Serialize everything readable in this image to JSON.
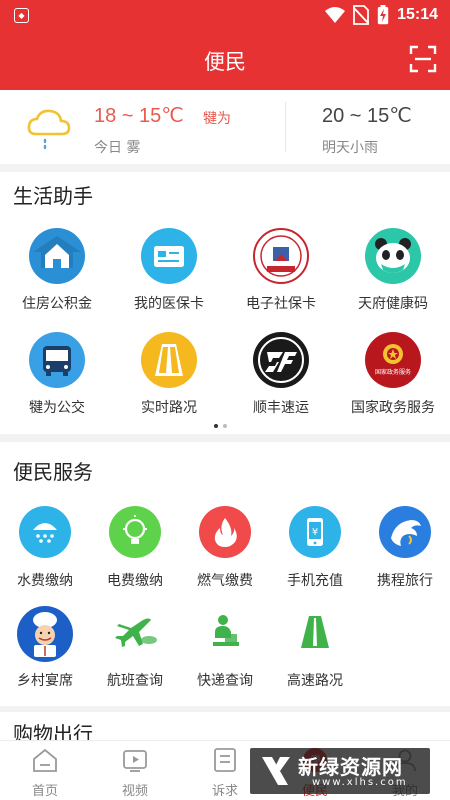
{
  "status_bar": {
    "time": "15:14"
  },
  "header": {
    "title": "便民"
  },
  "weather": {
    "today": {
      "temp": "18 ~ 15℃",
      "city": "犍为",
      "label": "今日 雾"
    },
    "tomorrow": {
      "temp": "20 ~ 15℃",
      "label": "明天小雨"
    }
  },
  "life_assistant": {
    "title": "生活助手",
    "items": [
      {
        "label": "住房公积金",
        "icon": "house-icon"
      },
      {
        "label": "我的医保卡",
        "icon": "medical-card-icon"
      },
      {
        "label": "电子社保卡",
        "icon": "social-security-card-icon"
      },
      {
        "label": "天府健康码",
        "icon": "panda-icon"
      },
      {
        "label": "犍为公交",
        "icon": "bus-icon"
      },
      {
        "label": "实时路况",
        "icon": "road-icon"
      },
      {
        "label": "顺丰速运",
        "icon": "sf-express-icon"
      },
      {
        "label": "国家政务服务",
        "icon": "national-emblem-icon"
      }
    ],
    "emblem_caption": "国家政务服务"
  },
  "convenience": {
    "title": "便民服务",
    "items": [
      {
        "label": "水费缴纳",
        "icon": "water-icon"
      },
      {
        "label": "电费缴纳",
        "icon": "bulb-icon"
      },
      {
        "label": "燃气缴费",
        "icon": "flame-icon"
      },
      {
        "label": "手机充值",
        "icon": "phone-icon"
      },
      {
        "label": "携程旅行",
        "icon": "dolphin-icon"
      },
      {
        "label": "乡村宴席",
        "icon": "chef-icon"
      },
      {
        "label": "航班查询",
        "icon": "plane-icon"
      },
      {
        "label": "快递查询",
        "icon": "courier-icon"
      },
      {
        "label": "高速路况",
        "icon": "highway-icon"
      }
    ]
  },
  "shopping": {
    "title": "购物出行"
  },
  "tabbar": {
    "tabs": [
      {
        "label": "首页",
        "icon": "home-icon"
      },
      {
        "label": "视频",
        "icon": "video-icon"
      },
      {
        "label": "诉求",
        "icon": "appeal-icon"
      },
      {
        "label": "便民",
        "icon": "convenience-icon",
        "active": true
      },
      {
        "label": "我的",
        "icon": "profile-icon"
      }
    ]
  },
  "watermark": {
    "title": "新绿资源网",
    "subtitle": "www.xlhs.com"
  },
  "colors": {
    "brand_red": "#e63232",
    "accent_orange": "#e85a4f"
  }
}
